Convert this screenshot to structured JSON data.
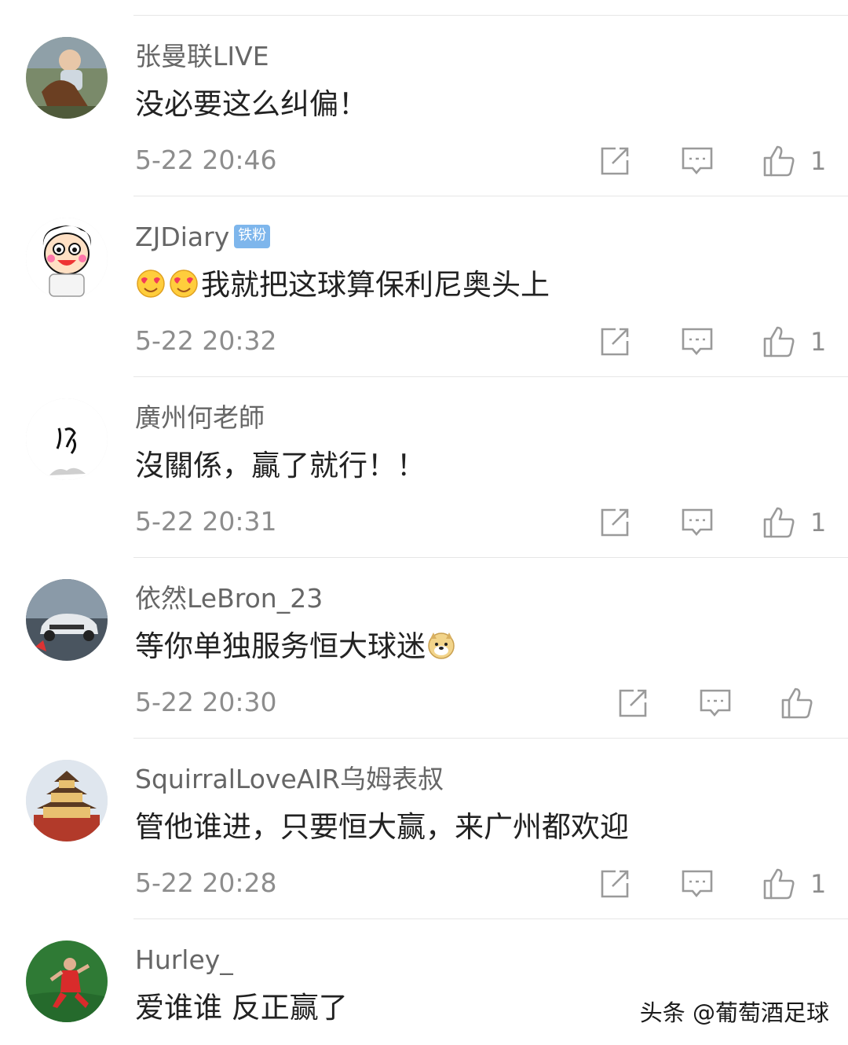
{
  "comments": [
    {
      "username": "张曼联LIVE",
      "badge": "",
      "text": "没必要这么纠偏！",
      "time": "5-22 20:46",
      "likes": "1"
    },
    {
      "username": "ZJDiary",
      "badge": "铁粉",
      "text": "我就把这球算保利尼奥头上",
      "time": "5-22 20:32",
      "likes": "1"
    },
    {
      "username": "廣州何老師",
      "badge": "",
      "text": "沒關係，贏了就行！！",
      "time": "5-22 20:31",
      "likes": "1"
    },
    {
      "username": "依然LeBron_23",
      "badge": "",
      "text": "等你单独服务恒大球迷",
      "time": "5-22 20:30",
      "likes": ""
    },
    {
      "username": "SquirralLoveAIR乌姆表叔",
      "badge": "",
      "text": "管他谁进，只要恒大赢，来广州都欢迎",
      "time": "5-22 20:28",
      "likes": "1"
    },
    {
      "username": "Hurley_",
      "badge": "",
      "text": "爱谁谁 反正赢了",
      "time": "",
      "likes": ""
    }
  ],
  "watermark": "头条 @葡萄酒足球",
  "icons": {
    "repost": "share-edit-icon",
    "reply": "comment-bubble-icon",
    "like": "thumbs-up-icon"
  },
  "colors": {
    "username": "#666666",
    "text": "#222222",
    "meta": "#8d8d8d",
    "badge": "#7eb6ec",
    "divider": "#e6e6e6"
  }
}
